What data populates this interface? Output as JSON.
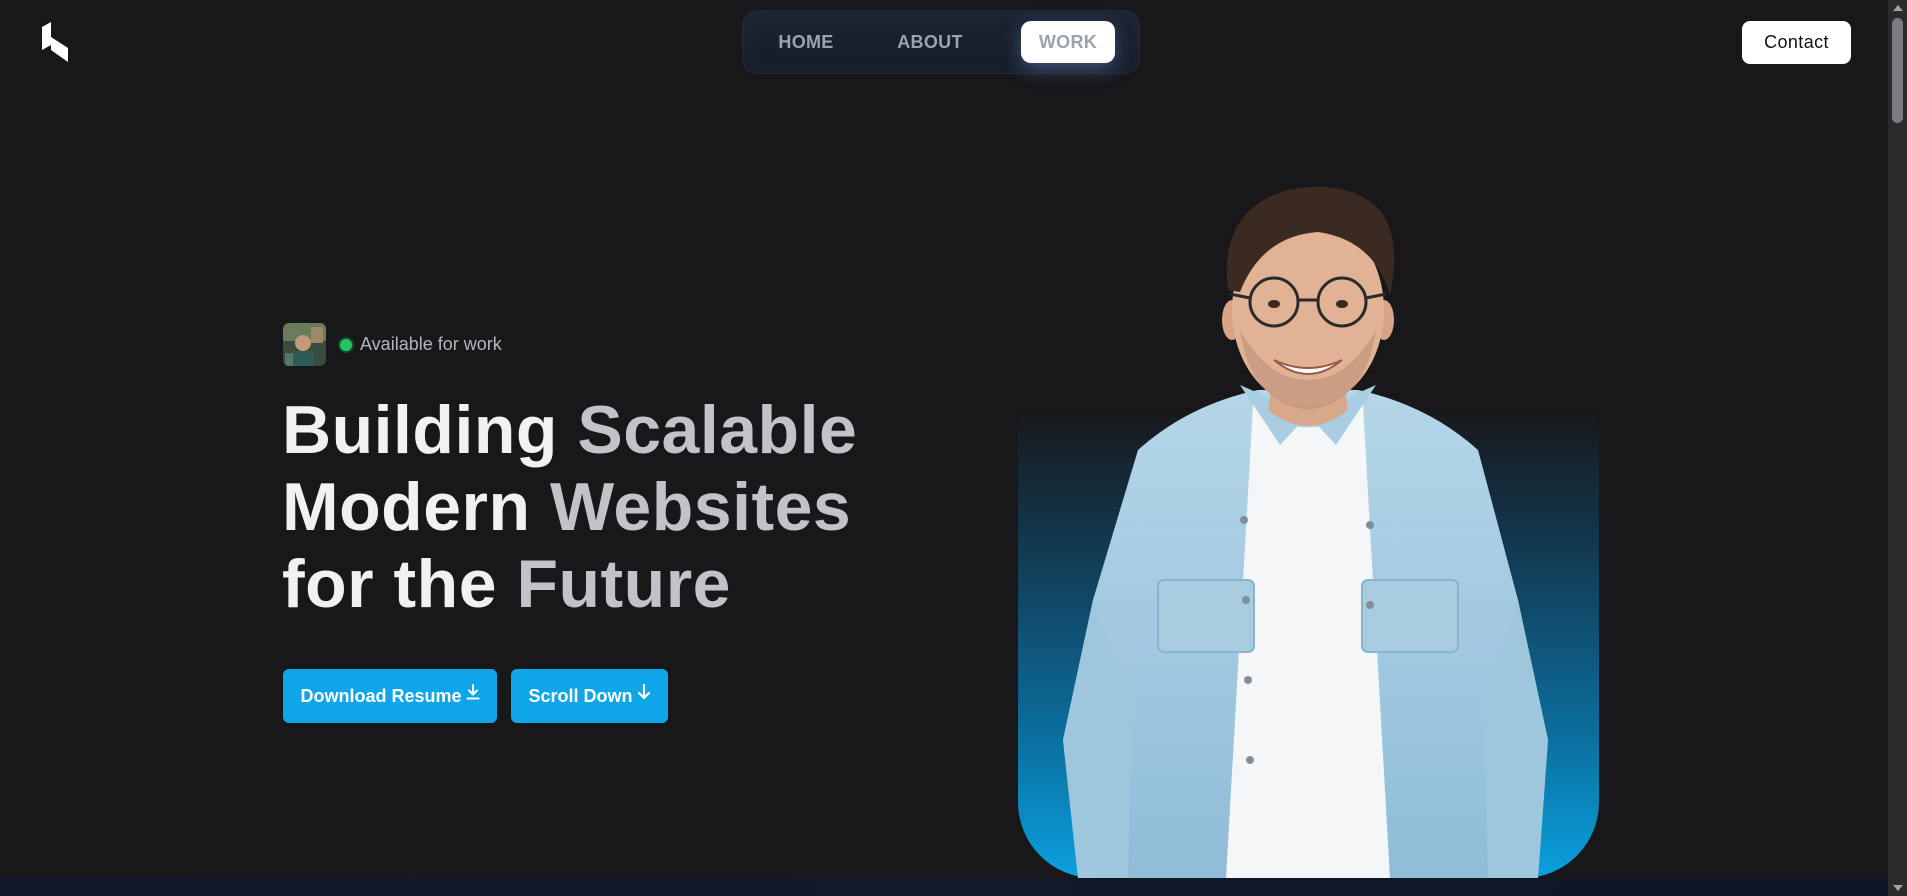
{
  "header": {
    "logo_icon": "k-logo-icon",
    "nav": {
      "home": "HOME",
      "about": "ABOUT",
      "work": "WORK",
      "active": "work"
    },
    "contact_label": "Contact"
  },
  "hero": {
    "status_text": "Available for work",
    "status_color": "#22c55e",
    "headline": {
      "line1_a": "Building",
      "line1_b": "Scalable",
      "line2_a": "Modern",
      "line2_b": "Websites",
      "line3_a": "for the",
      "line3_b": "Future"
    },
    "buttons": {
      "resume_label": "Download Resume",
      "resume_icon": "download-icon",
      "scroll_label": "Scroll Down",
      "scroll_icon": "arrow-down-icon"
    }
  },
  "colors": {
    "background": "#18181b",
    "accent": "#0ea5e9",
    "status": "#22c55e"
  }
}
